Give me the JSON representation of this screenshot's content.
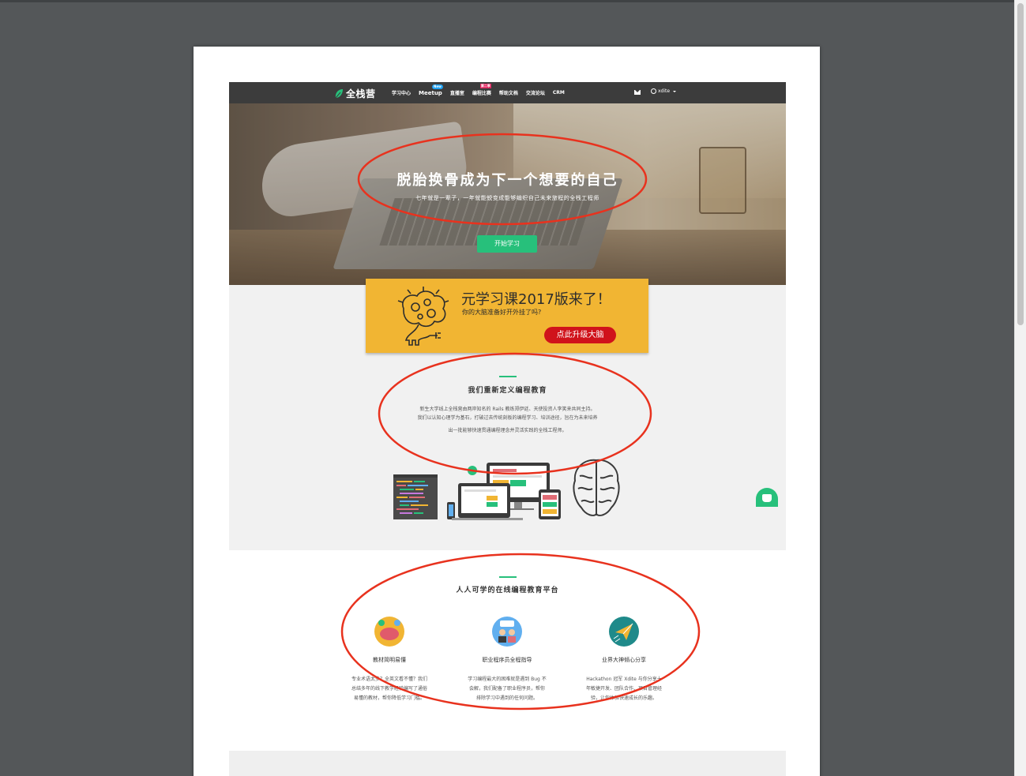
{
  "nav": {
    "logo": "全栈营",
    "items": [
      {
        "label": "学习中心"
      },
      {
        "label": "Meetup",
        "badge": "New"
      },
      {
        "label": "直播室"
      },
      {
        "label": "编程比赛",
        "badge": "第二季"
      },
      {
        "label": "帮助文档"
      },
      {
        "label": "交流论坛"
      },
      {
        "label": "CRM"
      }
    ],
    "username": "xdite"
  },
  "hero": {
    "title": "脱胎换骨成为下一个想要的自己",
    "subtitle": "七年就是一辈子，一年就能蜕变成能够编织自己未来旅程的全栈工程师",
    "button": "开始学习"
  },
  "banner": {
    "title": "元学习课2017版来了！",
    "subtitle": "你的大脑准备好开外挂了吗?",
    "button": "点此升级大脑"
  },
  "about": {
    "title": "我们重新定义编程教育",
    "lines": [
      "新生大学线上全栈营由两岸知名的 Rails 教练郑伊廷、天使投资人李笑来共同主持。",
      "我们以认知心理学为基石，打破过去传统刻板的编程学习、培训途径，旨在为未来培养",
      "出一批能够快速贯通编程理念并灵活实践的全栈工程师。"
    ]
  },
  "platform": {
    "title": "人人可学的在线编程教育平台",
    "features": [
      {
        "title": "教材简明易懂",
        "icon": "brain-question-icon",
        "desc": [
          "专业术语太多？全英文看不懂？我们",
          "总结多年的线下教学经验编写了通俗",
          "易懂的教材，帮你降低学习门槛。"
        ]
      },
      {
        "title": "职业程序员全程指导",
        "icon": "mentors-icon",
        "desc": [
          "学习编程最大的困难就是遇到 Bug 不",
          "会解，我们配备了职业程序员，帮你",
          "排除学习中遇到的任何问题。"
        ]
      },
      {
        "title": "业界大神倾心分享",
        "icon": "paper-plane-icon",
        "desc": [
          "Hackathon 冠军 Xdite 与你分享十",
          "年敏捷开发、团队合作、项目管理经",
          "验，让你体验快速成长的乐趣。"
        ]
      }
    ]
  },
  "colors": {
    "accent_green": "#27c07b",
    "banner_yellow": "#f1b533",
    "banner_red": "#d0121b",
    "annotation_red": "#e8321e",
    "nav_bg": "#3c3c3c"
  }
}
